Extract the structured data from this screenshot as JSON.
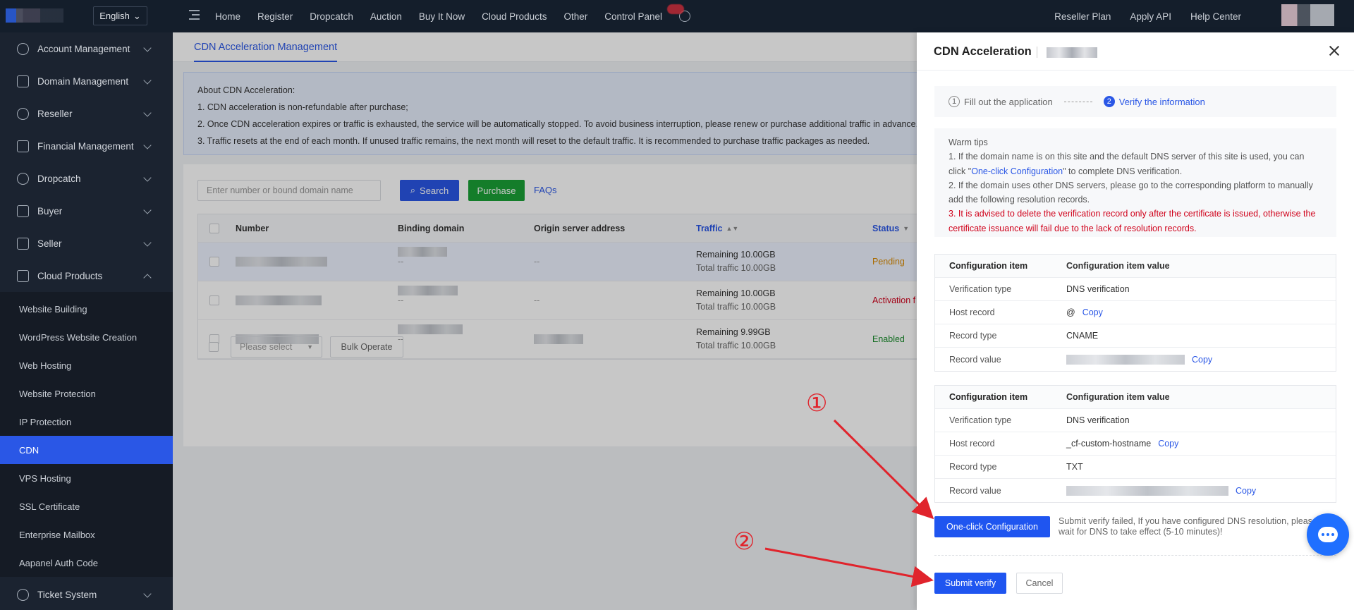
{
  "topbar": {
    "language": "English",
    "nav": [
      "Home",
      "Register",
      "Dropcatch",
      "Auction",
      "Buy It Now",
      "Cloud Products",
      "Other",
      "Control Panel"
    ],
    "right_nav": [
      "Reseller Plan",
      "Apply API",
      "Help Center"
    ]
  },
  "sidebar": {
    "groups": [
      {
        "label": "Account Management",
        "icon": "user-icon"
      },
      {
        "label": "Domain Management",
        "icon": "layers-icon"
      },
      {
        "label": "Reseller",
        "icon": "reseller-icon"
      },
      {
        "label": "Financial Management",
        "icon": "finance-icon"
      },
      {
        "label": "Dropcatch",
        "icon": "clock-icon"
      },
      {
        "label": "Buyer",
        "icon": "cart-icon"
      },
      {
        "label": "Seller",
        "icon": "seller-icon"
      },
      {
        "label": "Cloud Products",
        "icon": "cloud-icon"
      }
    ],
    "cloud_items": [
      "Website Building",
      "WordPress Website Creation",
      "Web Hosting",
      "Website Protection",
      "IP Protection",
      "CDN",
      "VPS Hosting",
      "SSL Certificate",
      "Enterprise Mailbox",
      "Aapanel Auth Code"
    ],
    "active_item": "CDN",
    "bottom_group": {
      "label": "Ticket System",
      "icon": "question-icon"
    }
  },
  "main": {
    "tab": "CDN Acceleration Management",
    "info": {
      "title": "About CDN Acceleration:",
      "lines": [
        "1. CDN acceleration is non-refundable after purchase;",
        "2. Once CDN acceleration expires or traffic is exhausted, the service will be automatically stopped. To avoid business interruption, please renew or purchase additional traffic in advance.",
        "3. Traffic resets at the end of each month. If unused traffic remains, the next month will reset to the default traffic. It is recommended to purchase traffic packages as needed."
      ]
    },
    "search_placeholder": "Enter number or bound domain name",
    "search_label": "Search",
    "purchase_label": "Purchase",
    "faq_label": "FAQs",
    "table": {
      "headers": [
        "Number",
        "Binding domain",
        "Origin server address",
        "Traffic",
        "Status"
      ],
      "rows": [
        {
          "sub": "--",
          "origin": "--",
          "remaining": "Remaining 10.00GB",
          "total": "Total traffic 10.00GB",
          "status": "Pending"
        },
        {
          "sub": "--",
          "origin": "--",
          "remaining": "Remaining 10.00GB",
          "total": "Total traffic 10.00GB",
          "status": "Activation f"
        },
        {
          "sub": "--",
          "origin": "",
          "remaining": "Remaining 9.99GB",
          "total": "Total traffic 10.00GB",
          "status": "Enabled"
        }
      ]
    },
    "bulk": {
      "select_placeholder": "Please select",
      "bulk_label": "Bulk Operate"
    }
  },
  "drawer": {
    "title": "CDN Acceleration",
    "steps": [
      {
        "num": "1",
        "label": "Fill out the application"
      },
      {
        "num": "2",
        "label": "Verify the information"
      }
    ],
    "tips": {
      "title": "Warm tips",
      "line1_a": "1. If the domain name is on this site and the default DNS server of this site is used, you can click \"",
      "line1_link": "One-click Configuration",
      "line1_b": "\" to complete DNS verification.",
      "line2": "2. If the domain uses other DNS servers, please go to the corresponding platform to manually add the following resolution records.",
      "line3": "3. It is advised to delete the verification record only after the certificate is issued, otherwise the certificate issuance will fail due to the lack of resolution records."
    },
    "cfg_header": {
      "key": "Configuration item",
      "value": "Configuration item value"
    },
    "cfg1": [
      {
        "key": "Verification type",
        "value": "DNS verification"
      },
      {
        "key": "Host record",
        "value": "@",
        "copy": "Copy"
      },
      {
        "key": "Record type",
        "value": "CNAME"
      },
      {
        "key": "Record value",
        "value": "",
        "copy": "Copy"
      }
    ],
    "cfg2": [
      {
        "key": "Verification type",
        "value": "DNS verification"
      },
      {
        "key": "Host record",
        "value": "_cf-custom-hostname",
        "copy": "Copy"
      },
      {
        "key": "Record type",
        "value": "TXT"
      },
      {
        "key": "Record value",
        "value": "",
        "copy": "Copy"
      }
    ],
    "oneclick_label": "One-click Configuration",
    "verify_msg": "Submit verify failed, If you have configured DNS resolution, please wait for DNS to take effect (5-10 minutes)!",
    "submit_label": "Submit verify",
    "cancel_label": "Cancel"
  },
  "annotations": {
    "one": "①",
    "two": "②",
    "color": "#e0242c"
  }
}
